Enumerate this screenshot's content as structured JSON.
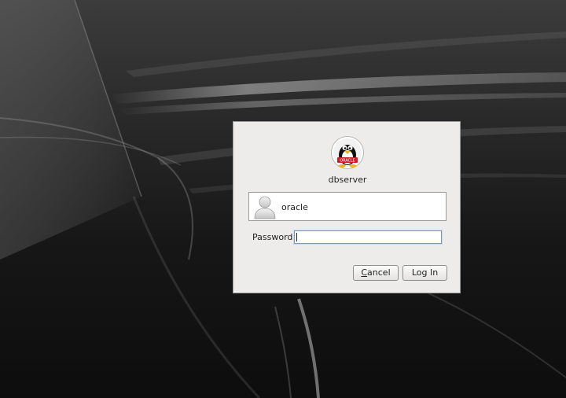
{
  "dialog": {
    "hostname": "dbserver",
    "logo_icon": "oracle-linux-penguin-icon",
    "logo_badge_text": "ORACLE"
  },
  "user": {
    "avatar_icon": "user-avatar-icon",
    "name": "oracle"
  },
  "password": {
    "label": "Password:",
    "value": ""
  },
  "buttons": {
    "cancel_mnemonic": "C",
    "cancel_rest": "ancel",
    "login_label": "Log In"
  },
  "colors": {
    "dialog_bg": "#edeceb",
    "focus_border": "#7a98c0",
    "badge_red": "#c8202a"
  }
}
